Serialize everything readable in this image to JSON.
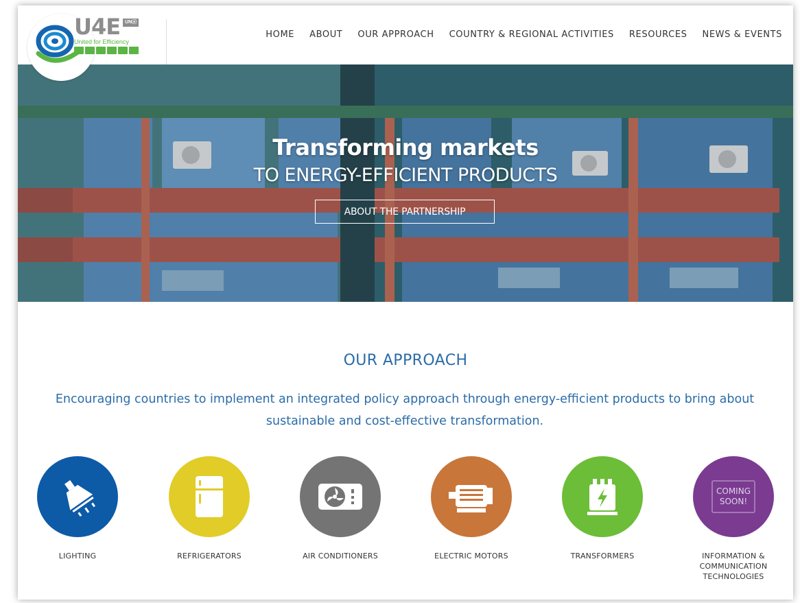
{
  "logo": {
    "brand": "U4E",
    "badge": "UNⓔ",
    "tagline": "United for Efficiency"
  },
  "nav": {
    "items": [
      {
        "label": "HOME"
      },
      {
        "label": "ABOUT"
      },
      {
        "label": "OUR APPROACH"
      },
      {
        "label": "COUNTRY & REGIONAL ACTIVITIES"
      },
      {
        "label": "RESOURCES"
      },
      {
        "label": "NEWS & EVENTS"
      }
    ]
  },
  "hero": {
    "title": "Transforming markets",
    "subtitle": "TO ENERGY-EFFICIENT PRODUCTS",
    "button_label": "ABOUT THE PARTNERSHIP"
  },
  "approach": {
    "title": "OUR APPROACH",
    "description": "Encouraging countries to implement an integrated policy approach through energy-efficient products to bring about sustainable and cost-effective transformation."
  },
  "products": [
    {
      "label": "LIGHTING",
      "icon": "lamp-icon",
      "color": "#0d5aa7"
    },
    {
      "label": "REFRIGERATORS",
      "icon": "refrigerator-icon",
      "color": "#e1cc28"
    },
    {
      "label": "AIR CONDITIONERS",
      "icon": "air-conditioner-icon",
      "color": "#747474"
    },
    {
      "label": "ELECTRIC MOTORS",
      "icon": "motor-icon",
      "color": "#c8763a"
    },
    {
      "label": "TRANSFORMERS",
      "icon": "transformer-icon",
      "color": "#6cbd38"
    },
    {
      "label": "INFORMATION & COMMUNICATION TECHNOLOGIES",
      "icon": "laptop-icon",
      "color": "#7a3b91",
      "overlay": "COMING SOON!"
    }
  ]
}
